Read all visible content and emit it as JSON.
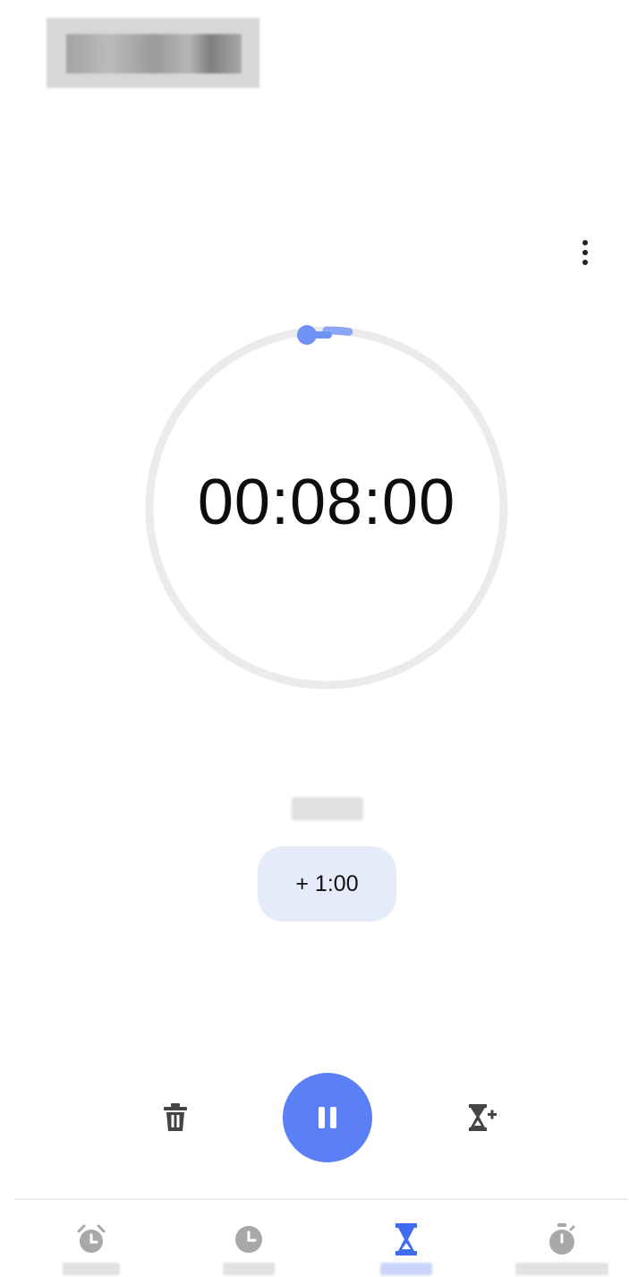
{
  "header": {
    "title_redacted": true
  },
  "timer": {
    "display": "00:08:00",
    "progress": 0.98,
    "accent": "#5b7ff4",
    "track": "#ebebeb"
  },
  "controls": {
    "add_label": "+ 1:00",
    "delete_icon": "trash-icon",
    "pause_icon": "pause-icon",
    "add_timer_icon": "hourglass-plus-icon"
  },
  "nav": {
    "items": [
      {
        "key": "alarm",
        "icon": "alarm-icon",
        "active": false
      },
      {
        "key": "clock",
        "icon": "clock-icon",
        "active": false
      },
      {
        "key": "timer",
        "icon": "hourglass-icon",
        "active": true
      },
      {
        "key": "stopwatch",
        "icon": "stopwatch-icon",
        "active": false
      }
    ],
    "active_color": "#3f6cf0",
    "inactive_color": "#a8a8a8"
  }
}
